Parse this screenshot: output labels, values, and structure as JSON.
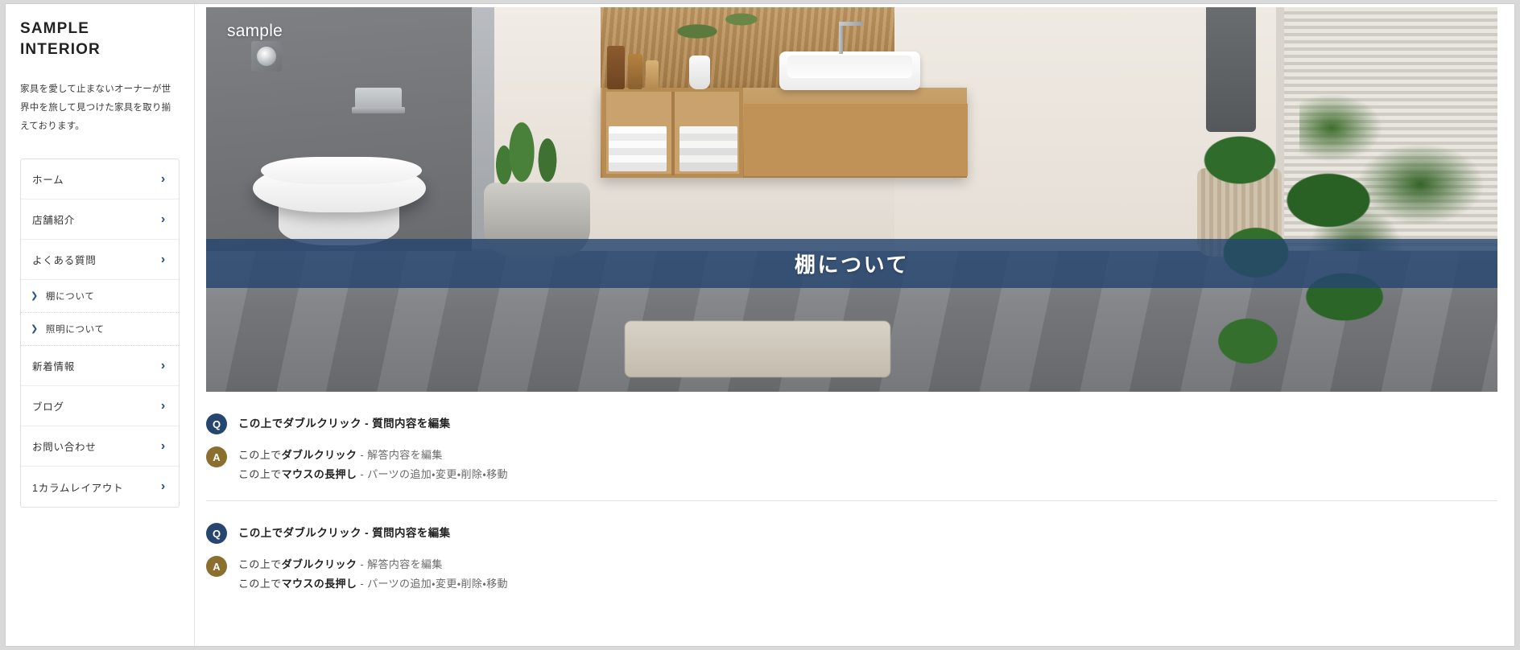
{
  "site": {
    "title_line1": "SAMPLE",
    "title_line2": "INTERIOR",
    "description": "家具を愛して止まないオーナーが世界中を旅して見つけた家具を取り揃えております。"
  },
  "sidebar": {
    "items": [
      {
        "label": "ホーム",
        "type": "main",
        "icon": "chevron-right-icon"
      },
      {
        "label": "店舗紹介",
        "type": "main",
        "icon": "chevron-right-icon"
      },
      {
        "label": "よくある質問",
        "type": "main",
        "icon": "chevron-right-icon"
      },
      {
        "label": "棚について",
        "type": "sub",
        "icon": "chevron-right-icon"
      },
      {
        "label": "照明について",
        "type": "sub",
        "icon": "chevron-right-icon"
      },
      {
        "label": "新着情報",
        "type": "main",
        "icon": "chevron-right-icon"
      },
      {
        "label": "ブログ",
        "type": "main",
        "icon": "chevron-right-icon"
      },
      {
        "label": "お問い合わせ",
        "type": "main",
        "icon": "chevron-right-icon"
      },
      {
        "label": "1カラムレイアウト",
        "type": "main",
        "icon": "chevron-right-icon"
      }
    ],
    "chevron_glyph": "›",
    "sub_chevron_glyph": "❯"
  },
  "hero": {
    "watermark": "sample",
    "banner_title": "棚について",
    "banner_color": "#264670"
  },
  "faq": {
    "blocks": [
      {
        "question": {
          "badge": "Q",
          "prefix": "この上でダブルクリック",
          "separator": "-",
          "suffix": "質問内容を編集"
        },
        "answer": {
          "badge": "A",
          "lines": [
            {
              "plain": "この上で",
              "bold": "ダブルクリック",
              "separator": "-",
              "tail": "解答内容を編集"
            },
            {
              "plain": "この上で",
              "bold": "マウスの長押し",
              "separator": "-",
              "tail": "パーツの追加・変更・削除・移動"
            }
          ]
        }
      },
      {
        "question": {
          "badge": "Q",
          "prefix": "この上でダブルクリック",
          "separator": "-",
          "suffix": "質問内容を編集"
        },
        "answer": {
          "badge": "A",
          "lines": [
            {
              "plain": "この上で",
              "bold": "ダブルクリック",
              "separator": "-",
              "tail": "解答内容を編集"
            },
            {
              "plain": "この上で",
              "bold": "マウスの長押し",
              "separator": "-",
              "tail": "パーツの追加・変更・削除・移動"
            }
          ]
        }
      }
    ]
  },
  "colors": {
    "accent_navy": "#26456f",
    "accent_olive": "#8a6f2f",
    "banner": "#264670"
  }
}
